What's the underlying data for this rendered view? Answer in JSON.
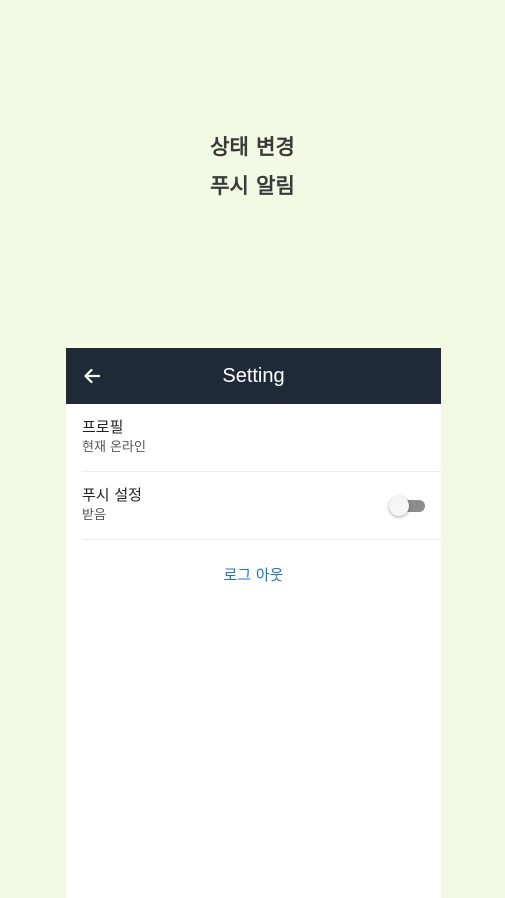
{
  "caption": {
    "line1": "상태 변경",
    "line2": "푸시 알림"
  },
  "appbar": {
    "title": "Setting",
    "back_icon": "arrow-left-icon"
  },
  "settings": {
    "profile": {
      "title": "프로필",
      "subtitle": "현재 온라인"
    },
    "push": {
      "title": "푸시 설정",
      "subtitle": "받음",
      "toggle_on": false
    }
  },
  "logout_label": "로그 아웃",
  "colors": {
    "background": "#f2fae4",
    "appbar": "#1f2a38",
    "link": "#1976d2"
  }
}
